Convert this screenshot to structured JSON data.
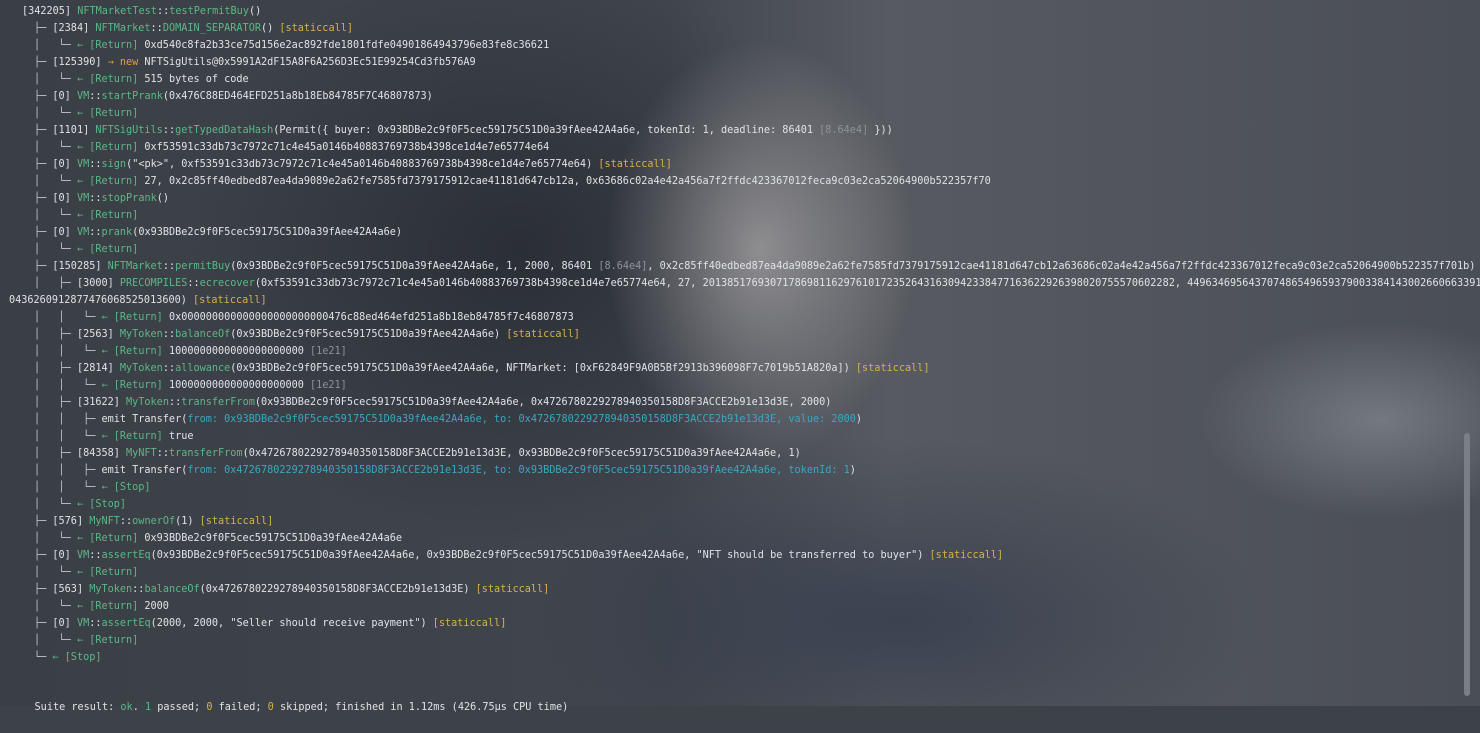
{
  "lines": [
    {
      "segs": [
        {
          "t": "[342205] ",
          "c": "gas"
        },
        {
          "t": "NFTMarketTest",
          "c": "contract"
        },
        {
          "t": "::",
          "c": "arg"
        },
        {
          "t": "testPermitBuy",
          "c": "func"
        },
        {
          "t": "()",
          "c": "arg"
        }
      ]
    },
    {
      "segs": [
        {
          "t": "├─ ",
          "c": "tree"
        },
        {
          "t": "[2384] ",
          "c": "gas"
        },
        {
          "t": "NFTMarket",
          "c": "contract"
        },
        {
          "t": "::",
          "c": "arg"
        },
        {
          "t": "DOMAIN_SEPARATOR",
          "c": "func"
        },
        {
          "t": "() ",
          "c": "arg"
        },
        {
          "t": "[staticcall]",
          "c": "tag"
        }
      ]
    },
    {
      "segs": [
        {
          "t": "│   └─ ",
          "c": "tree"
        },
        {
          "t": "← [Return] ",
          "c": "ret"
        },
        {
          "t": "0xd540c8fa2b33ce75d156e2ac892fde1801fdfe04901864943796e83fe8c36621",
          "c": "arg"
        }
      ]
    },
    {
      "segs": [
        {
          "t": "├─ ",
          "c": "tree"
        },
        {
          "t": "[125390] ",
          "c": "gas"
        },
        {
          "t": "→ new ",
          "c": "newkw"
        },
        {
          "t": "NFTSigUtils@0x5991A2dF15A8F6A256D3Ec51E99254Cd3fb576A9",
          "c": "arg"
        }
      ]
    },
    {
      "segs": [
        {
          "t": "│   └─ ",
          "c": "tree"
        },
        {
          "t": "← [Return] ",
          "c": "ret"
        },
        {
          "t": "515 bytes of code",
          "c": "arg"
        }
      ]
    },
    {
      "segs": [
        {
          "t": "├─ ",
          "c": "tree"
        },
        {
          "t": "[0] ",
          "c": "gas"
        },
        {
          "t": "VM",
          "c": "contract"
        },
        {
          "t": "::",
          "c": "arg"
        },
        {
          "t": "startPrank",
          "c": "func"
        },
        {
          "t": "(0x476C88ED464EFD251a8b18Eb84785F7C46807873)",
          "c": "arg"
        }
      ]
    },
    {
      "segs": [
        {
          "t": "│   └─ ",
          "c": "tree"
        },
        {
          "t": "← [Return]",
          "c": "ret"
        }
      ]
    },
    {
      "segs": [
        {
          "t": "├─ ",
          "c": "tree"
        },
        {
          "t": "[1101] ",
          "c": "gas"
        },
        {
          "t": "NFTSigUtils",
          "c": "contract"
        },
        {
          "t": "::",
          "c": "arg"
        },
        {
          "t": "getTypedDataHash",
          "c": "func"
        },
        {
          "t": "(Permit({ buyer: 0x93BDBe2c9f0F5cec59175C51D0a39fAee42A4a6e, tokenId: 1, deadline: 86401 ",
          "c": "arg"
        },
        {
          "t": "[8.64e4]",
          "c": "dim"
        },
        {
          "t": " }))",
          "c": "arg"
        }
      ]
    },
    {
      "segs": [
        {
          "t": "│   └─ ",
          "c": "tree"
        },
        {
          "t": "← [Return] ",
          "c": "ret"
        },
        {
          "t": "0xf53591c33db73c7972c71c4e45a0146b40883769738b4398ce1d4e7e65774e64",
          "c": "arg"
        }
      ]
    },
    {
      "segs": [
        {
          "t": "├─ ",
          "c": "tree"
        },
        {
          "t": "[0] ",
          "c": "gas"
        },
        {
          "t": "VM",
          "c": "contract"
        },
        {
          "t": "::",
          "c": "arg"
        },
        {
          "t": "sign",
          "c": "func"
        },
        {
          "t": "(\"<pk>\", 0xf53591c33db73c7972c71c4e45a0146b40883769738b4398ce1d4e7e65774e64) ",
          "c": "arg"
        },
        {
          "t": "[staticcall]",
          "c": "tag"
        }
      ]
    },
    {
      "segs": [
        {
          "t": "│   └─ ",
          "c": "tree"
        },
        {
          "t": "← [Return] ",
          "c": "ret"
        },
        {
          "t": "27, 0x2c85ff40edbed87ea4da9089e2a62fe7585fd7379175912cae41181d647cb12a, 0x63686c02a4e42a456a7f2ffdc423367012feca9c03e2ca52064900b522357f70",
          "c": "arg"
        }
      ]
    },
    {
      "segs": [
        {
          "t": "├─ ",
          "c": "tree"
        },
        {
          "t": "[0] ",
          "c": "gas"
        },
        {
          "t": "VM",
          "c": "contract"
        },
        {
          "t": "::",
          "c": "arg"
        },
        {
          "t": "stopPrank",
          "c": "func"
        },
        {
          "t": "()",
          "c": "arg"
        }
      ]
    },
    {
      "segs": [
        {
          "t": "│   └─ ",
          "c": "tree"
        },
        {
          "t": "← [Return]",
          "c": "ret"
        }
      ]
    },
    {
      "segs": [
        {
          "t": "├─ ",
          "c": "tree"
        },
        {
          "t": "[0] ",
          "c": "gas"
        },
        {
          "t": "VM",
          "c": "contract"
        },
        {
          "t": "::",
          "c": "arg"
        },
        {
          "t": "prank",
          "c": "func"
        },
        {
          "t": "(0x93BDBe2c9f0F5cec59175C51D0a39fAee42A4a6e)",
          "c": "arg"
        }
      ]
    },
    {
      "segs": [
        {
          "t": "│   └─ ",
          "c": "tree"
        },
        {
          "t": "← [Return]",
          "c": "ret"
        }
      ]
    },
    {
      "segs": [
        {
          "t": "├─ ",
          "c": "tree"
        },
        {
          "t": "[150285] ",
          "c": "gas"
        },
        {
          "t": "NFTMarket",
          "c": "contract"
        },
        {
          "t": "::",
          "c": "arg"
        },
        {
          "t": "permitBuy",
          "c": "func"
        },
        {
          "t": "(0x93BDBe2c9f0F5cec59175C51D0a39fAee42A4a6e, 1, 2000, 86401 ",
          "c": "arg"
        },
        {
          "t": "[8.64e4]",
          "c": "dim"
        },
        {
          "t": ", 0x2c85ff40edbed87ea4da9089e2a62fe7585fd7379175912cae41181d647cb12a63686c02a4e42a456a7f2ffdc423367012feca9c03e2ca52064900b522357f701b)",
          "c": "arg"
        }
      ]
    },
    {
      "segs": [
        {
          "t": "│   ├─ ",
          "c": "tree"
        },
        {
          "t": "[3000] ",
          "c": "gas"
        },
        {
          "t": "PRECOMPILES",
          "c": "contract"
        },
        {
          "t": "::",
          "c": "arg"
        },
        {
          "t": "ecrecover",
          "c": "func"
        },
        {
          "t": "(0xf53591c33db73c7972c71c4e45a0146b40883769738b4398ce1d4e7e65774e64, 27, 20138517693071786981162976101723526431630942338477163622926398020755570602282, 4496346956437074865496593790033841430026606633910",
          "c": "arg"
        }
      ]
    },
    {
      "segs": [
        {
          "t": "0436260912877476068525013600) ",
          "c": "arg"
        },
        {
          "t": "[staticcall]",
          "c": "tag"
        }
      ]
    },
    {
      "segs": [
        {
          "t": "│   │   └─ ",
          "c": "tree"
        },
        {
          "t": "← [Return] ",
          "c": "ret"
        },
        {
          "t": "0x000000000000000000000000476c88ed464efd251a8b18eb84785f7c46807873",
          "c": "arg"
        }
      ]
    },
    {
      "segs": [
        {
          "t": "│   ├─ ",
          "c": "tree"
        },
        {
          "t": "[2563] ",
          "c": "gas"
        },
        {
          "t": "MyToken",
          "c": "contract"
        },
        {
          "t": "::",
          "c": "arg"
        },
        {
          "t": "balanceOf",
          "c": "func"
        },
        {
          "t": "(0x93BDBe2c9f0F5cec59175C51D0a39fAee42A4a6e) ",
          "c": "arg"
        },
        {
          "t": "[staticcall]",
          "c": "tag"
        }
      ]
    },
    {
      "segs": [
        {
          "t": "│   │   └─ ",
          "c": "tree"
        },
        {
          "t": "← [Return] ",
          "c": "ret"
        },
        {
          "t": "1000000000000000000000 ",
          "c": "arg"
        },
        {
          "t": "[1e21]",
          "c": "dim"
        }
      ]
    },
    {
      "segs": [
        {
          "t": "│   ├─ ",
          "c": "tree"
        },
        {
          "t": "[2814] ",
          "c": "gas"
        },
        {
          "t": "MyToken",
          "c": "contract"
        },
        {
          "t": "::",
          "c": "arg"
        },
        {
          "t": "allowance",
          "c": "func"
        },
        {
          "t": "(0x93BDBe2c9f0F5cec59175C51D0a39fAee42A4a6e, NFTMarket: [0xF62849F9A0B5Bf2913b396098F7c7019b51A820a]) ",
          "c": "arg"
        },
        {
          "t": "[staticcall]",
          "c": "tag"
        }
      ]
    },
    {
      "segs": [
        {
          "t": "│   │   └─ ",
          "c": "tree"
        },
        {
          "t": "← [Return] ",
          "c": "ret"
        },
        {
          "t": "1000000000000000000000 ",
          "c": "arg"
        },
        {
          "t": "[1e21]",
          "c": "dim"
        }
      ]
    },
    {
      "segs": [
        {
          "t": "│   ├─ ",
          "c": "tree"
        },
        {
          "t": "[31622] ",
          "c": "gas"
        },
        {
          "t": "MyToken",
          "c": "contract"
        },
        {
          "t": "::",
          "c": "arg"
        },
        {
          "t": "transferFrom",
          "c": "func"
        },
        {
          "t": "(0x93BDBe2c9f0F5cec59175C51D0a39fAee42A4a6e, 0x4726780229278940350158D8F3ACCE2b91e13d3E, 2000)",
          "c": "arg"
        }
      ]
    },
    {
      "segs": [
        {
          "t": "│   │   ├─ ",
          "c": "tree"
        },
        {
          "t": "emit Transfer(",
          "c": "arg"
        },
        {
          "t": "from: 0x93BDBe2c9f0F5cec59175C51D0a39fAee42A4a6e, to: 0x4726780229278940350158D8F3ACCE2b91e13d3E, value: 2000",
          "c": "emitargs"
        },
        {
          "t": ")",
          "c": "arg"
        }
      ]
    },
    {
      "segs": [
        {
          "t": "│   │   └─ ",
          "c": "tree"
        },
        {
          "t": "← [Return] ",
          "c": "ret"
        },
        {
          "t": "true",
          "c": "arg"
        }
      ]
    },
    {
      "segs": [
        {
          "t": "│   ├─ ",
          "c": "tree"
        },
        {
          "t": "[84358] ",
          "c": "gas"
        },
        {
          "t": "MyNFT",
          "c": "contract"
        },
        {
          "t": "::",
          "c": "arg"
        },
        {
          "t": "transferFrom",
          "c": "func"
        },
        {
          "t": "(0x4726780229278940350158D8F3ACCE2b91e13d3E, 0x93BDBe2c9f0F5cec59175C51D0a39fAee42A4a6e, 1)",
          "c": "arg"
        }
      ]
    },
    {
      "segs": [
        {
          "t": "│   │   ├─ ",
          "c": "tree"
        },
        {
          "t": "emit Transfer(",
          "c": "arg"
        },
        {
          "t": "from: 0x4726780229278940350158D8F3ACCE2b91e13d3E, to: 0x93BDBe2c9f0F5cec59175C51D0a39fAee42A4a6e, tokenId: 1",
          "c": "emitargs"
        },
        {
          "t": ")",
          "c": "arg"
        }
      ]
    },
    {
      "segs": [
        {
          "t": "│   │   └─ ",
          "c": "tree"
        },
        {
          "t": "← [Stop]",
          "c": "stop"
        }
      ]
    },
    {
      "segs": [
        {
          "t": "│   └─ ",
          "c": "tree"
        },
        {
          "t": "← [Stop]",
          "c": "stop"
        }
      ]
    },
    {
      "segs": [
        {
          "t": "├─ ",
          "c": "tree"
        },
        {
          "t": "[576] ",
          "c": "gas"
        },
        {
          "t": "MyNFT",
          "c": "contract"
        },
        {
          "t": "::",
          "c": "arg"
        },
        {
          "t": "ownerOf",
          "c": "func"
        },
        {
          "t": "(1) ",
          "c": "arg"
        },
        {
          "t": "[staticcall]",
          "c": "tag"
        }
      ]
    },
    {
      "segs": [
        {
          "t": "│   └─ ",
          "c": "tree"
        },
        {
          "t": "← [Return] ",
          "c": "ret"
        },
        {
          "t": "0x93BDBe2c9f0F5cec59175C51D0a39fAee42A4a6e",
          "c": "arg"
        }
      ]
    },
    {
      "segs": [
        {
          "t": "├─ ",
          "c": "tree"
        },
        {
          "t": "[0] ",
          "c": "gas"
        },
        {
          "t": "VM",
          "c": "contract"
        },
        {
          "t": "::",
          "c": "arg"
        },
        {
          "t": "assertEq",
          "c": "func"
        },
        {
          "t": "(0x93BDBe2c9f0F5cec59175C51D0a39fAee42A4a6e, 0x93BDBe2c9f0F5cec59175C51D0a39fAee42A4a6e, \"NFT should be transferred to buyer\") ",
          "c": "arg"
        },
        {
          "t": "[staticcall]",
          "c": "tag"
        }
      ]
    },
    {
      "segs": [
        {
          "t": "│   └─ ",
          "c": "tree"
        },
        {
          "t": "← [Return]",
          "c": "ret"
        }
      ]
    },
    {
      "segs": [
        {
          "t": "├─ ",
          "c": "tree"
        },
        {
          "t": "[563] ",
          "c": "gas"
        },
        {
          "t": "MyToken",
          "c": "contract"
        },
        {
          "t": "::",
          "c": "arg"
        },
        {
          "t": "balanceOf",
          "c": "func"
        },
        {
          "t": "(0x4726780229278940350158D8F3ACCE2b91e13d3E) ",
          "c": "arg"
        },
        {
          "t": "[staticcall]",
          "c": "tag"
        }
      ]
    },
    {
      "segs": [
        {
          "t": "│   └─ ",
          "c": "tree"
        },
        {
          "t": "← [Return] ",
          "c": "ret"
        },
        {
          "t": "2000",
          "c": "arg"
        }
      ]
    },
    {
      "segs": [
        {
          "t": "├─ ",
          "c": "tree"
        },
        {
          "t": "[0] ",
          "c": "gas"
        },
        {
          "t": "VM",
          "c": "contract"
        },
        {
          "t": "::",
          "c": "arg"
        },
        {
          "t": "assertEq",
          "c": "func"
        },
        {
          "t": "(2000, 2000, \"Seller should receive payment\") ",
          "c": "arg"
        },
        {
          "t": "[staticcall]",
          "c": "tag"
        }
      ]
    },
    {
      "segs": [
        {
          "t": "│   └─ ",
          "c": "tree"
        },
        {
          "t": "← [Return]",
          "c": "ret"
        }
      ]
    },
    {
      "segs": [
        {
          "t": "└─ ",
          "c": "tree"
        },
        {
          "t": "← [Stop]",
          "c": "stop"
        }
      ]
    }
  ],
  "summary": {
    "prefix": "Suite result: ",
    "status": "ok",
    "mid1": ". ",
    "passed_count": "1",
    "passed_label": " passed; ",
    "failed_count": "0",
    "failed_label": " failed; ",
    "skipped_count": "0",
    "skipped_label": " skipped; finished in 1.12ms (426.75µs CPU time)"
  },
  "colors": {
    "green": "#5bb887",
    "yellow": "#d6b24a",
    "cyan": "#3aa7c2",
    "orange": "#e0a23a"
  }
}
